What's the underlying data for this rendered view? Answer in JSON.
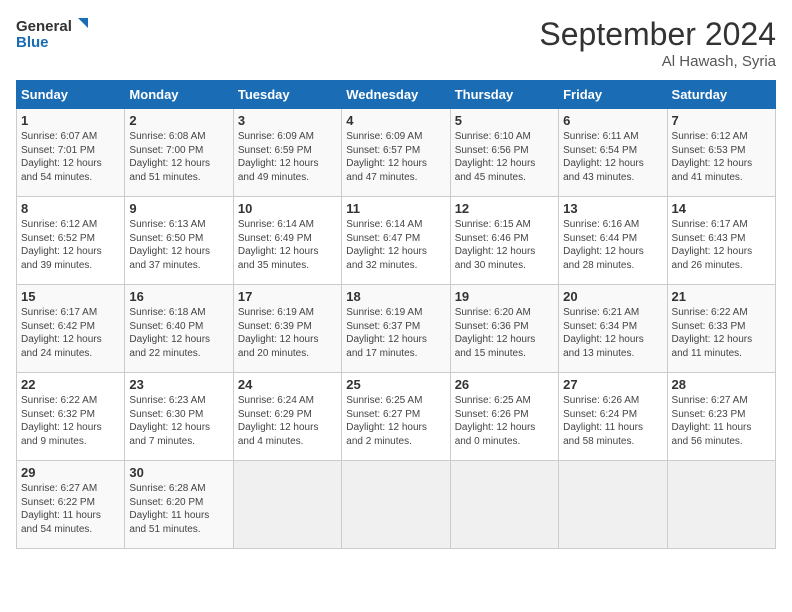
{
  "header": {
    "logo_line1": "General",
    "logo_line2": "Blue",
    "month_title": "September 2024",
    "location": "Al Hawash, Syria"
  },
  "days_of_week": [
    "Sunday",
    "Monday",
    "Tuesday",
    "Wednesday",
    "Thursday",
    "Friday",
    "Saturday"
  ],
  "weeks": [
    [
      {
        "num": "1",
        "rise": "6:07 AM",
        "set": "7:01 PM",
        "daylight": "12 hours and 54 minutes."
      },
      {
        "num": "2",
        "rise": "6:08 AM",
        "set": "7:00 PM",
        "daylight": "12 hours and 51 minutes."
      },
      {
        "num": "3",
        "rise": "6:09 AM",
        "set": "6:59 PM",
        "daylight": "12 hours and 49 minutes."
      },
      {
        "num": "4",
        "rise": "6:09 AM",
        "set": "6:57 PM",
        "daylight": "12 hours and 47 minutes."
      },
      {
        "num": "5",
        "rise": "6:10 AM",
        "set": "6:56 PM",
        "daylight": "12 hours and 45 minutes."
      },
      {
        "num": "6",
        "rise": "6:11 AM",
        "set": "6:54 PM",
        "daylight": "12 hours and 43 minutes."
      },
      {
        "num": "7",
        "rise": "6:12 AM",
        "set": "6:53 PM",
        "daylight": "12 hours and 41 minutes."
      }
    ],
    [
      {
        "num": "8",
        "rise": "6:12 AM",
        "set": "6:52 PM",
        "daylight": "12 hours and 39 minutes."
      },
      {
        "num": "9",
        "rise": "6:13 AM",
        "set": "6:50 PM",
        "daylight": "12 hours and 37 minutes."
      },
      {
        "num": "10",
        "rise": "6:14 AM",
        "set": "6:49 PM",
        "daylight": "12 hours and 35 minutes."
      },
      {
        "num": "11",
        "rise": "6:14 AM",
        "set": "6:47 PM",
        "daylight": "12 hours and 32 minutes."
      },
      {
        "num": "12",
        "rise": "6:15 AM",
        "set": "6:46 PM",
        "daylight": "12 hours and 30 minutes."
      },
      {
        "num": "13",
        "rise": "6:16 AM",
        "set": "6:44 PM",
        "daylight": "12 hours and 28 minutes."
      },
      {
        "num": "14",
        "rise": "6:17 AM",
        "set": "6:43 PM",
        "daylight": "12 hours and 26 minutes."
      }
    ],
    [
      {
        "num": "15",
        "rise": "6:17 AM",
        "set": "6:42 PM",
        "daylight": "12 hours and 24 minutes."
      },
      {
        "num": "16",
        "rise": "6:18 AM",
        "set": "6:40 PM",
        "daylight": "12 hours and 22 minutes."
      },
      {
        "num": "17",
        "rise": "6:19 AM",
        "set": "6:39 PM",
        "daylight": "12 hours and 20 minutes."
      },
      {
        "num": "18",
        "rise": "6:19 AM",
        "set": "6:37 PM",
        "daylight": "12 hours and 17 minutes."
      },
      {
        "num": "19",
        "rise": "6:20 AM",
        "set": "6:36 PM",
        "daylight": "12 hours and 15 minutes."
      },
      {
        "num": "20",
        "rise": "6:21 AM",
        "set": "6:34 PM",
        "daylight": "12 hours and 13 minutes."
      },
      {
        "num": "21",
        "rise": "6:22 AM",
        "set": "6:33 PM",
        "daylight": "12 hours and 11 minutes."
      }
    ],
    [
      {
        "num": "22",
        "rise": "6:22 AM",
        "set": "6:32 PM",
        "daylight": "12 hours and 9 minutes."
      },
      {
        "num": "23",
        "rise": "6:23 AM",
        "set": "6:30 PM",
        "daylight": "12 hours and 7 minutes."
      },
      {
        "num": "24",
        "rise": "6:24 AM",
        "set": "6:29 PM",
        "daylight": "12 hours and 4 minutes."
      },
      {
        "num": "25",
        "rise": "6:25 AM",
        "set": "6:27 PM",
        "daylight": "12 hours and 2 minutes."
      },
      {
        "num": "26",
        "rise": "6:25 AM",
        "set": "6:26 PM",
        "daylight": "12 hours and 0 minutes."
      },
      {
        "num": "27",
        "rise": "6:26 AM",
        "set": "6:24 PM",
        "daylight": "11 hours and 58 minutes."
      },
      {
        "num": "28",
        "rise": "6:27 AM",
        "set": "6:23 PM",
        "daylight": "11 hours and 56 minutes."
      }
    ],
    [
      {
        "num": "29",
        "rise": "6:27 AM",
        "set": "6:22 PM",
        "daylight": "11 hours and 54 minutes."
      },
      {
        "num": "30",
        "rise": "6:28 AM",
        "set": "6:20 PM",
        "daylight": "11 hours and 51 minutes."
      },
      null,
      null,
      null,
      null,
      null
    ]
  ],
  "labels": {
    "sunrise": "Sunrise:",
    "sunset": "Sunset:",
    "daylight": "Daylight:"
  }
}
